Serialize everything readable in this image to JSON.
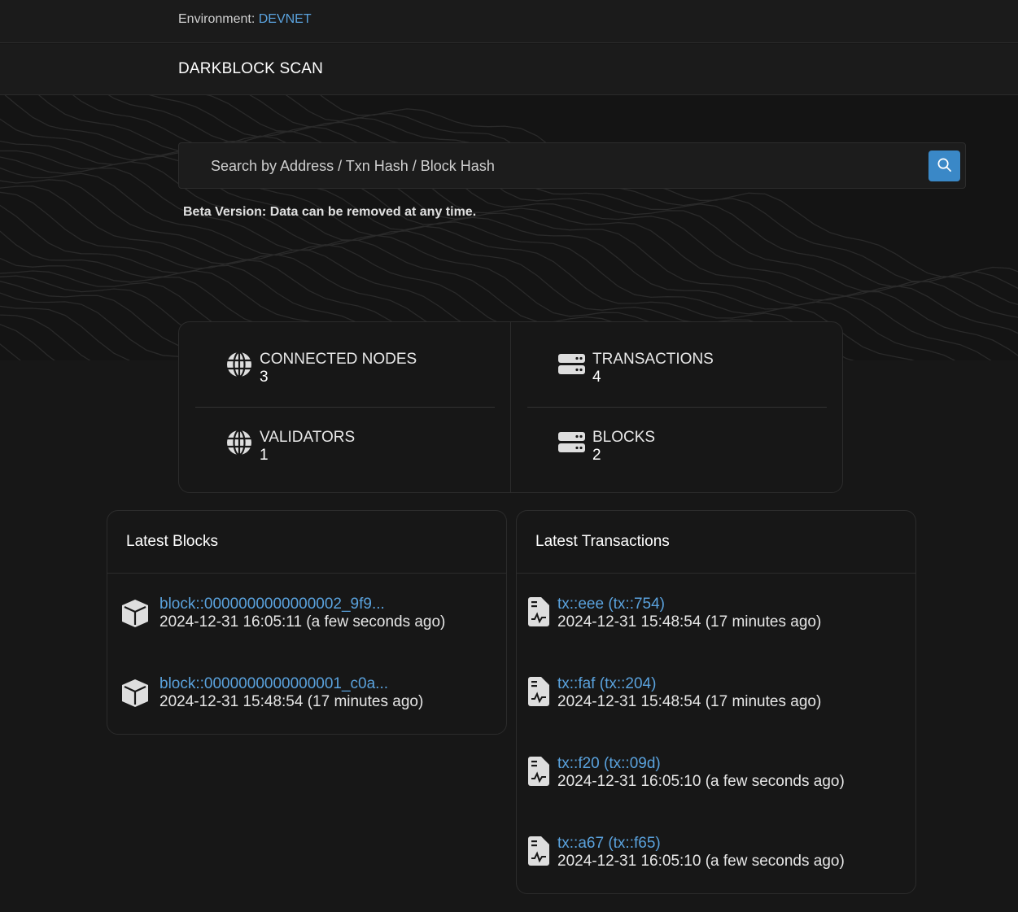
{
  "environment": {
    "label": "Environment:",
    "value": "DEVNET"
  },
  "brand": "DARKBLOCK SCAN",
  "search": {
    "placeholder": "Search by Address / Txn Hash / Block Hash",
    "button_icon": "search-icon"
  },
  "beta_notice": "Beta Version: Data can be removed at any time.",
  "stats": {
    "connected_nodes": {
      "label": "CONNECTED NODES",
      "value": "3",
      "icon": "globe-icon"
    },
    "transactions": {
      "label": "TRANSACTIONS",
      "value": "4",
      "icon": "server-icon"
    },
    "validators": {
      "label": "VALIDATORS",
      "value": "1",
      "icon": "globe-icon"
    },
    "blocks": {
      "label": "BLOCKS",
      "value": "2",
      "icon": "server-icon"
    }
  },
  "latest_blocks": {
    "title": "Latest Blocks",
    "items": [
      {
        "id": "block::0000000000000002_9f9...",
        "time": "2024-12-31 16:05:11 (a few seconds ago)",
        "icon": "cube-icon"
      },
      {
        "id": "block::0000000000000001_c0a...",
        "time": "2024-12-31 15:48:54 (17 minutes ago)",
        "icon": "cube-icon"
      }
    ]
  },
  "latest_transactions": {
    "title": "Latest Transactions",
    "items": [
      {
        "id": "tx::eee (tx::754)",
        "time": "2024-12-31 15:48:54 (17 minutes ago)",
        "icon": "receipt-icon"
      },
      {
        "id": "tx::faf (tx::204)",
        "time": "2024-12-31 15:48:54 (17 minutes ago)",
        "icon": "receipt-icon"
      },
      {
        "id": "tx::f20 (tx::09d)",
        "time": "2024-12-31 16:05:10 (a few seconds ago)",
        "icon": "receipt-icon"
      },
      {
        "id": "tx::a67 (tx::f65)",
        "time": "2024-12-31 16:05:10 (a few seconds ago)",
        "icon": "receipt-icon"
      }
    ]
  },
  "colors": {
    "accent": "#5aa2dd",
    "button": "#3a88c7",
    "background": "#171717"
  }
}
